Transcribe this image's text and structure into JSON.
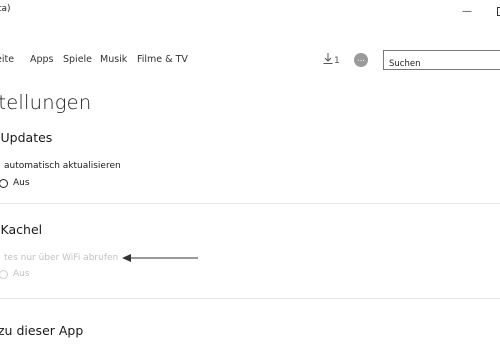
{
  "window": {
    "title": "ta)",
    "minimize_glyph": "—"
  },
  "nav": {
    "items": [
      "eite",
      "Apps",
      "Spiele",
      "Musik",
      "Filme & TV"
    ]
  },
  "downloads": {
    "icon": "download-icon",
    "count": "1"
  },
  "account": {
    "icon": "avatar-icon",
    "glyph": "..."
  },
  "search": {
    "placeholder": "Suchen"
  },
  "page": {
    "title": "stellungen"
  },
  "sections": {
    "updates": {
      "title": "-Updates",
      "setting_label": "automatisch aktualisieren",
      "toggle_state": "Aus"
    },
    "tile": {
      "title": "-Kachel",
      "setting_label": "tes nur über WiFi abrufen",
      "toggle_state": "Aus"
    },
    "about": {
      "title": "zu dieser App"
    }
  },
  "colors": {
    "text": "#1a1a1a",
    "disabled": "#c2c2c2",
    "divider": "#e6e6e6",
    "arrow": "#333333"
  }
}
